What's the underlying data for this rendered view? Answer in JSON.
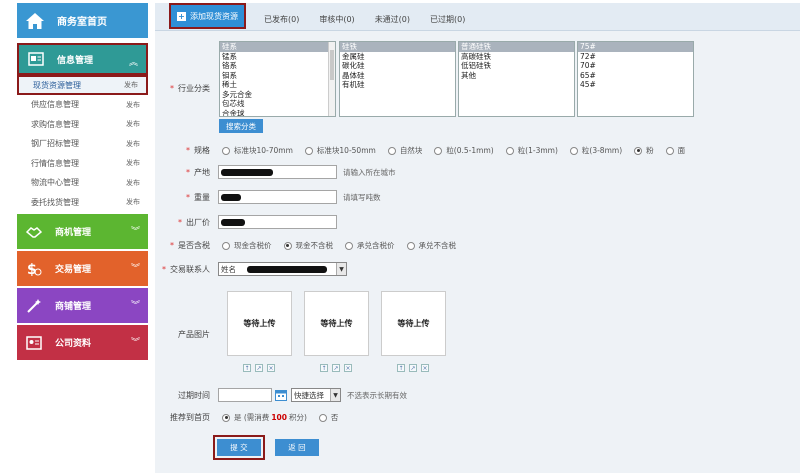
{
  "sidebar": {
    "home": "商务室首页",
    "info": "信息管理",
    "info_items": [
      {
        "label": "现货资源管理",
        "status": "发布"
      },
      {
        "label": "供应信息管理",
        "status": "发布"
      },
      {
        "label": "求购信息管理",
        "status": "发布"
      },
      {
        "label": "钢厂招标管理",
        "status": "发布"
      },
      {
        "label": "行情信息管理",
        "status": "发布"
      },
      {
        "label": "物流中心管理",
        "status": "发布"
      },
      {
        "label": "委托找货管理",
        "status": "发布"
      }
    ],
    "biz": "商机管理",
    "trade": "交易管理",
    "store": "商铺管理",
    "company": "公司资料"
  },
  "tabs": [
    {
      "label": "添加现货资源"
    },
    {
      "label": "已发布(0)"
    },
    {
      "label": "审核中(0)"
    },
    {
      "label": "未通过(0)"
    },
    {
      "label": "已过期(0)"
    }
  ],
  "form": {
    "industry_label": "行业分类",
    "list1": [
      "硅系",
      "锰系",
      "铬系",
      "钼系",
      "稀土",
      "多元合金",
      "包芯线",
      "合金球"
    ],
    "list2": [
      "硅铁",
      "金属硅",
      "碳化硅",
      "晶体硅",
      "有机硅"
    ],
    "list3": [
      "普通硅铁",
      "高碳硅铁",
      "低铝硅铁",
      "其他"
    ],
    "list4": [
      "75#",
      "72#",
      "70#",
      "65#",
      "45#"
    ],
    "search_btn": "搜索分类",
    "spec_label": "规格",
    "spec_options": [
      "标准块10-70mm",
      "标准块10-50mm",
      "自然块",
      "粒(0.5-1mm)",
      "粒(1-3mm)",
      "粒(3-8mm)",
      "粉",
      "面"
    ],
    "spec_selected": 6,
    "origin_label": "产地",
    "origin_hint": "请输入所在城市",
    "weight_label": "重量",
    "weight_hint": "请填写吨数",
    "price_label": "出厂价",
    "tax_label": "是否含税",
    "tax_options": [
      "现金含税价",
      "现金不含税",
      "承兑含税价",
      "承兑不含税"
    ],
    "tax_selected": 1,
    "contact_label": "交易联系人",
    "contact_value": "姓名",
    "image_label": "产品图片",
    "upload_text": "等待上传",
    "expire_label": "过期时间",
    "quick_select": "快捷选择",
    "expire_hint": "不选表示长期有效",
    "recommend_label": "推荐到首页",
    "recommend_yes_pre": "是 (需消费",
    "recommend_points": "100",
    "recommend_yes_post": "积分)",
    "recommend_no": "否",
    "submit": "提 交",
    "back": "返 回"
  },
  "colors": {
    "home": "#3a97d2",
    "info": "#2f9a96",
    "biz": "#5cb631",
    "trade": "#e2622b",
    "store": "#8b46c2",
    "company": "#c23045",
    "highlight": "#8b1a1a",
    "points": "#cc0000"
  }
}
